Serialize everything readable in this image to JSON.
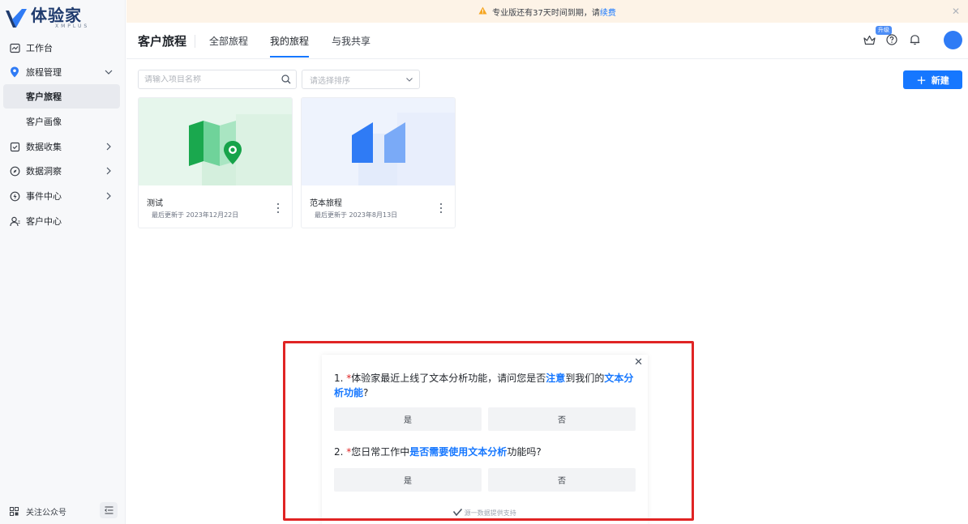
{
  "brand": {
    "name": "体验家",
    "subname": "XMPLUS"
  },
  "banner": {
    "text": "专业版还有37天时间到期，请",
    "link": "续费"
  },
  "sidebar": {
    "items": [
      {
        "label": "工作台"
      },
      {
        "label": "旅程管理"
      },
      {
        "label": "客户旅程"
      },
      {
        "label": "客户画像"
      },
      {
        "label": "数据收集"
      },
      {
        "label": "数据洞察"
      },
      {
        "label": "事件中心"
      },
      {
        "label": "客户中心"
      }
    ],
    "footer_label": "关注公众号"
  },
  "header": {
    "title": "客户旅程",
    "tabs": [
      {
        "label": "全部旅程"
      },
      {
        "label": "我的旅程"
      },
      {
        "label": "与我共享"
      }
    ],
    "upgrade_badge": "升级"
  },
  "toolbar": {
    "search_placeholder": "请输入项目名称",
    "sort_placeholder": "请选择排序",
    "new_label": "新建"
  },
  "cards": [
    {
      "title": "测试",
      "updated": "最后更新于 2023年12月22日"
    },
    {
      "title": "范本旅程",
      "updated": "最后更新于 2023年8月13日"
    }
  ],
  "survey": {
    "q1": {
      "number": "1.",
      "req": "*",
      "p1": "体验家最近上线了文本分析功能，请问您是否",
      "h1": "注意",
      "p2": "到我们的",
      "h2": "文本分析功能",
      "p3": "?"
    },
    "q1_options": [
      "是",
      "否"
    ],
    "q2": {
      "number": "2.",
      "req": "*",
      "p1": "您日常工作中",
      "h1": "是否需要使用文本分析",
      "p2": "功能吗?"
    },
    "q2_options": [
      "是",
      "否"
    ],
    "footer": "源一数据提供支持"
  },
  "colors": {
    "primary": "#1677ff",
    "banner_bg": "#fdf3e7",
    "highlight_border": "#e02424"
  }
}
